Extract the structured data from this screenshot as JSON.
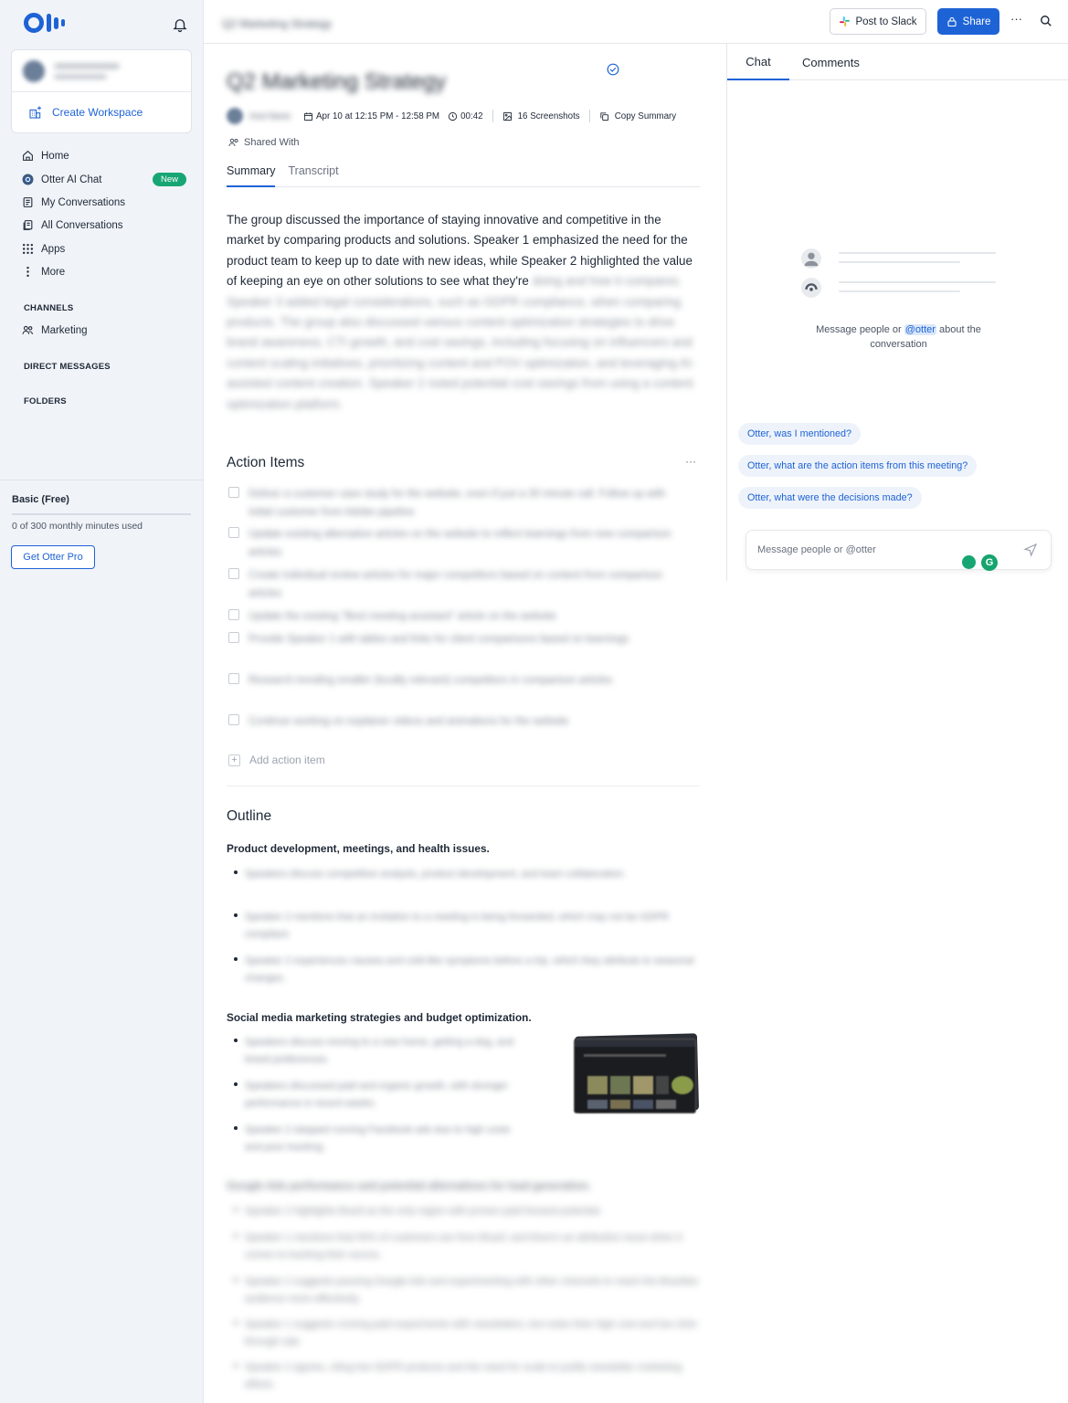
{
  "sidebar": {
    "workspace_name": "Otter Workspace",
    "create_workspace": "Create Workspace",
    "nav": [
      {
        "label": "Home",
        "icon": "home-icon"
      },
      {
        "label": "Otter AI Chat",
        "icon": "otter-chat-icon",
        "badge": "New"
      },
      {
        "label": "My Conversations",
        "icon": "document-icon"
      },
      {
        "label": "All Conversations",
        "icon": "documents-icon"
      },
      {
        "label": "Apps",
        "icon": "apps-grid-icon"
      },
      {
        "label": "More",
        "icon": "more-vertical-icon"
      }
    ],
    "channels_heading": "CHANNELS",
    "channels": [
      {
        "label": "Marketing",
        "icon": "people-icon"
      }
    ],
    "direct_messages_heading": "DIRECT MESSAGES",
    "folders_heading": "FOLDERS",
    "plan_name": "Basic (Free)",
    "usage": "0 of 300 monthly minutes used",
    "upgrade_button": "Get Otter Pro"
  },
  "header": {
    "breadcrumb": "Q2 Marketing Strategy",
    "post_to_slack": "Post to Slack",
    "share": "Share"
  },
  "conversation": {
    "title": "Q2 Marketing Strategy",
    "owner": "Host Name",
    "date_time": "Apr 10 at 12:15 PM - 12:58 PM",
    "duration": "00:42",
    "screenshots": "16 Screenshots",
    "copy_summary": "Copy Summary",
    "shared_with": "Shared With",
    "tabs": [
      "Summary",
      "Transcript"
    ],
    "summary_visible": "The group discussed the importance of staying innovative and competitive in the market by comparing products and solutions. Speaker 1 emphasized the need for the product team to keep up to date with new ideas, while Speaker 2 highlighted the value of keeping an eye on other solutions to see what they're",
    "summary_hidden": "doing and how it compares. Speaker 3 added legal considerations, such as GDPR compliance, when comparing products. The group also discussed various content optimization strategies to drive brand awareness, CTI growth, and cost savings, including focusing on influencers and content scaling initiatives, prioritizing content and POV optimization, and leveraging AI-assisted content creation. Speaker 2 noted potential cost savings from using a content optimization platform.",
    "action_items_title": "Action Items",
    "action_items": [
      "Deliver a customer case study for the website, even if just a 30 minute call. Follow up with initial customer from Adobe pipeline",
      "Update existing alternative articles on the website to reflect learnings from new comparison articles",
      "Create individual review articles for major competitors based on content from comparison articles",
      "Update the existing \"Best meeting assistant\" article on the website",
      "Provide Speaker 1 with tables and links for client comparisons based on learnings",
      "Research trending smaller (locally relevant) competitors in comparison articles",
      "Continue working on explainer videos and animations for the website"
    ],
    "add_action_item": "Add action item",
    "outline_title": "Outline",
    "outline_sections": [
      {
        "heading": "Product development, meetings, and health issues.",
        "bullets": [
          "Speakers discuss competitive analysis, product development, and team collaboration.",
          "Speaker 2 mentions that an invitation to a meeting is being forwarded, which may not be GDPR compliant.",
          "Speaker 2 experiences nausea and cold-like symptoms before a trip, which they attribute to seasonal changes."
        ]
      },
      {
        "heading": "Social media marketing strategies and budget optimization.",
        "bullets": [
          "Speakers discuss moving to a new home, getting a dog, and breed preferences.",
          "Speakers discussed paid and organic growth, with stronger performance in recent weeks.",
          "Speaker 2 stopped running Facebook ads due to high costs and poor tracking."
        ]
      },
      {
        "heading": "Google Ads performance and potential alternatives for lead generation.",
        "bullets": [
          "Speaker 2 highlights Brazil as the only region with proven paid forward potential.",
          "Speaker 1 mentions that 50% of customers are from Brazil, and there's an attribution issue when it comes to tracking their source.",
          "Speaker 2 suggests pausing Google Ads and experimenting with other channels to reach the Brazilian audience more effectively.",
          "Speaker 1 suggests running paid experiments with newsletters, but notes their high cost and low click-through rate.",
          "Speaker 2 agrees, citing low GDPR products and the need for scale to justify newsletter marketing efforts."
        ]
      }
    ]
  },
  "chat": {
    "tabs": [
      "Chat",
      "Comments"
    ],
    "empty_prefix": "Message people or ",
    "empty_mention": "@otter",
    "empty_suffix": " about the conversation",
    "suggestions": [
      "Otter, was I mentioned?",
      "Otter, what are the action items from this meeting?",
      "Otter, what were the decisions made?"
    ],
    "input_placeholder": "Message people or @otter"
  },
  "colors": {
    "accent": "#1e63d6",
    "new_badge": "#17a673",
    "sidebar_bg": "#f0f3f8"
  }
}
